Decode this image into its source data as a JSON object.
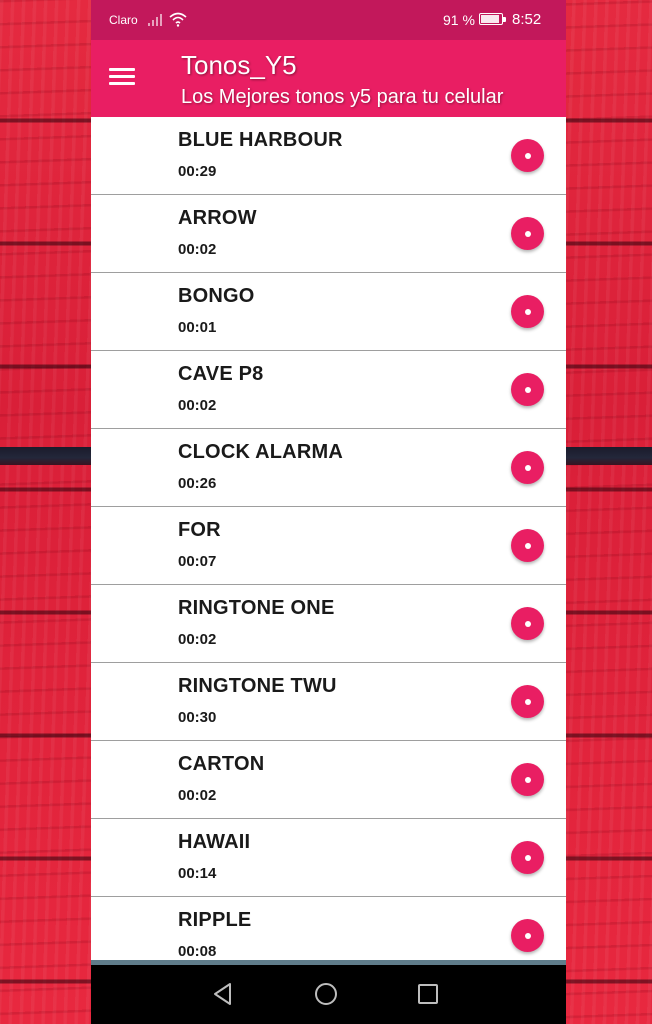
{
  "status_bar": {
    "carrier": "Claro",
    "battery_percent": "91 %",
    "time": "8:52",
    "icons": [
      "signal-icon",
      "wifi-icon",
      "battery-icon"
    ]
  },
  "app_bar": {
    "title": "Tonos_Y5",
    "subtitle": "Los Mejores tonos y5 para tu celular",
    "menu_icon": "hamburger-menu-icon",
    "color": "#e91e63"
  },
  "ringtones": [
    {
      "name": "BLUE HARBOUR",
      "duration": "00:29"
    },
    {
      "name": "ARROW",
      "duration": "00:02"
    },
    {
      "name": "BONGO",
      "duration": "00:01"
    },
    {
      "name": "CAVE P8",
      "duration": "00:02"
    },
    {
      "name": "CLOCK ALARMA",
      "duration": "00:26"
    },
    {
      "name": "FOR",
      "duration": "00:07"
    },
    {
      "name": "RINGTONE ONE",
      "duration": "00:02"
    },
    {
      "name": "RINGTONE TWU",
      "duration": "00:30"
    },
    {
      "name": "CARTON",
      "duration": "00:02"
    },
    {
      "name": "HAWAII",
      "duration": "00:14"
    },
    {
      "name": "RIPPLE",
      "duration": "00:08"
    }
  ],
  "nav_bar": {
    "icons": [
      "back-icon",
      "home-icon",
      "recents-icon"
    ]
  },
  "colors": {
    "accent": "#e91e63",
    "status_bar": "#c2185b",
    "background": "#e3213a"
  }
}
